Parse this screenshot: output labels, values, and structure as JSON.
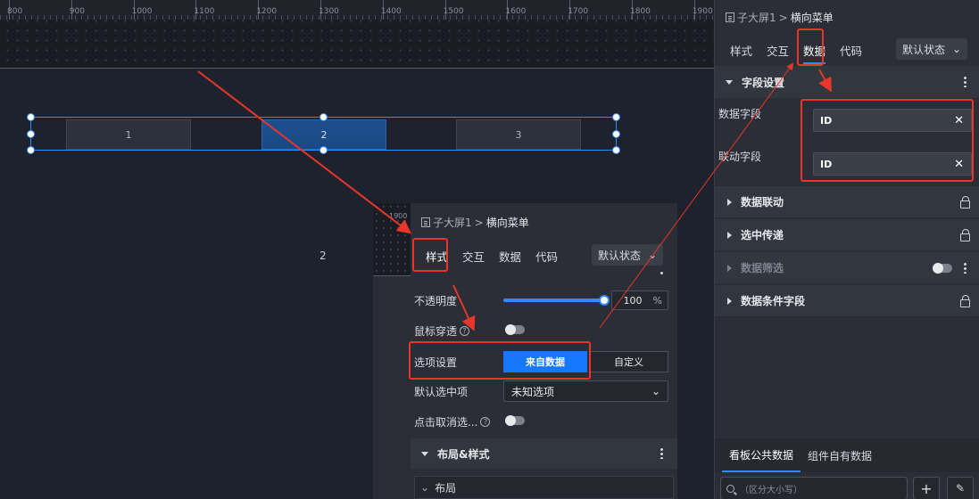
{
  "ruler": {
    "ticks": [
      "800",
      "900",
      "1000",
      "1100",
      "1200",
      "1300",
      "1400",
      "1500",
      "1600",
      "1700",
      "1800",
      "1900"
    ]
  },
  "canvas": {
    "menu_items": [
      "1",
      "2",
      "3"
    ],
    "active_index": 1,
    "selected_label": "2"
  },
  "inset": {
    "ruler_tick": "1900",
    "breadcrumb": {
      "parent": "子大屏1",
      "separator": ">",
      "current": "横向菜单"
    },
    "tabs": [
      "样式",
      "交互",
      "数据",
      "代码"
    ],
    "state_select": "默认状态",
    "opacity": {
      "label": "不透明度",
      "value": "100",
      "unit": "%",
      "level": 1.0
    },
    "mouse_through": {
      "label": "鼠标穿透",
      "on": false
    },
    "option_setting": {
      "label": "选项设置",
      "options": [
        "来自数据",
        "自定义"
      ],
      "selected": "来自数据"
    },
    "default_selected": {
      "label": "默认选中项",
      "value": "未知选项"
    },
    "click_cancel": {
      "label": "点击取消选...",
      "on": false
    },
    "section_layout": "布局&样式",
    "subsection_layout": "布局"
  },
  "right": {
    "breadcrumb": {
      "parent": "子大屏1",
      "separator": ">",
      "current": "横向菜单"
    },
    "tabs": [
      "样式",
      "交互",
      "数据",
      "代码"
    ],
    "active_tab": "数据",
    "state_select": "默认状态",
    "field_section": "字段设置",
    "data_field": {
      "label": "数据字段",
      "value": "ID"
    },
    "link_field": {
      "label": "联动字段",
      "value": "ID"
    },
    "sections": [
      {
        "label": "数据联动",
        "icon": "lock-icon",
        "dim": false
      },
      {
        "label": "选中传递",
        "icon": "lock-icon",
        "dim": false
      },
      {
        "label": "数据筛选",
        "icon": "toggle",
        "dim": true
      },
      {
        "label": "数据条件字段",
        "icon": "lock-icon",
        "dim": false
      }
    ],
    "bottom_tabs": [
      "看板公共数据",
      "组件自有数据"
    ],
    "search_placeholder": "（区分大小写）"
  },
  "colors": {
    "accent": "#2f8cff",
    "annotation_red": "#e8362a",
    "panel_bg": "#2b2e36"
  }
}
